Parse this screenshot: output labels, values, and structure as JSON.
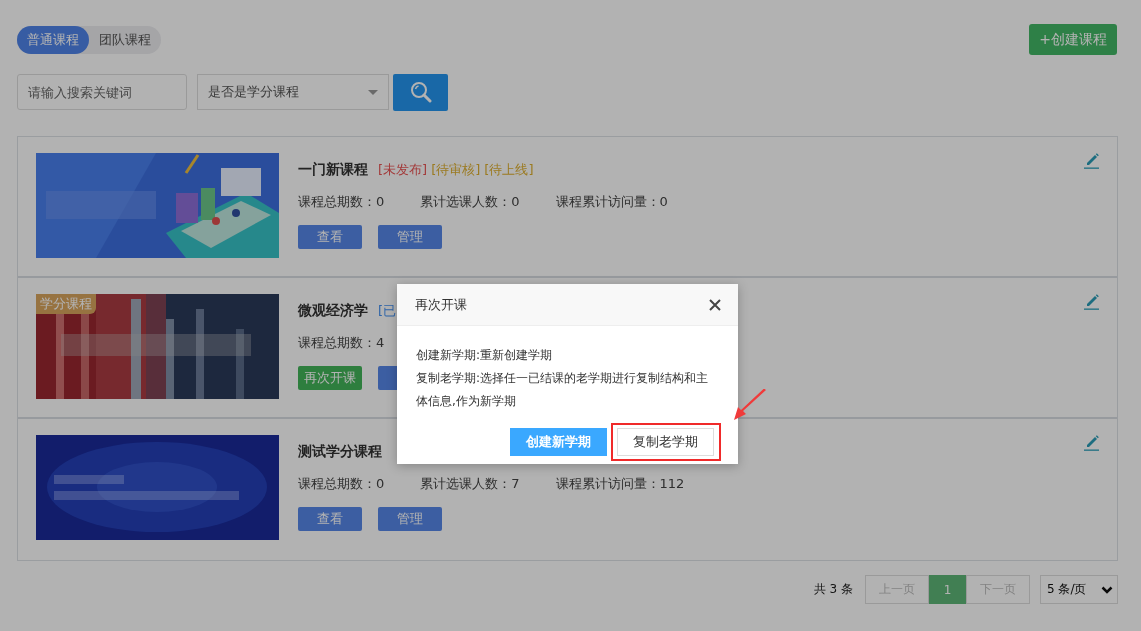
{
  "tabs": [
    {
      "label": "普通课程",
      "selected": true
    },
    {
      "label": "团队课程",
      "selected": false
    }
  ],
  "create_button": {
    "label": "+创建课程"
  },
  "search": {
    "placeholder": "请输入搜索关键词"
  },
  "filter": {
    "placeholder": "是否是学分课程"
  },
  "courses": [
    {
      "title": "一门新课程",
      "picture": {
        "kind": "picture"
      },
      "tags": [
        {
          "text": "[未发布]",
          "color": "#a33a3a"
        },
        {
          "text": "[待审核]",
          "color": "#9b7a20"
        },
        {
          "text": "[待上线]",
          "color": "#9b7a20"
        }
      ],
      "stats": [
        "课程总期数：0",
        "累计选课人数：0",
        "课程累计访问量：0"
      ],
      "buttons": [
        {
          "label": "查看",
          "kind": "primary"
        },
        {
          "label": "管理",
          "kind": "primary"
        }
      ]
    },
    {
      "title": "微观经济学",
      "credit_badge": "学分课程",
      "picture": {
        "kind": "picture"
      },
      "tags": [
        {
          "text": "[已",
          "color": "#2e64a8"
        }
      ],
      "stats": [
        "课程总期数：4"
      ],
      "buttons": [
        {
          "label": "再次开课",
          "kind": "success"
        },
        {
          "kind": "primary"
        }
      ]
    },
    {
      "title": "测试学分课程",
      "picture": {
        "kind": "picture"
      },
      "stats": [
        "课程总期数：0",
        "累计选课人数：7",
        "课程累计访问量：112"
      ],
      "buttons": [
        {
          "label": "查看",
          "kind": "primary"
        },
        {
          "label": "管理",
          "kind": "primary"
        }
      ]
    }
  ],
  "pagination": {
    "total": "共 3 条",
    "prev": {
      "label": "上一页",
      "disabled": true
    },
    "pages": [
      {
        "label": "1",
        "selected": true
      }
    ],
    "next": {
      "label": "下一页",
      "disabled": true
    },
    "page_size": "5 条/页"
  },
  "dialog": {
    "title": "再次开课",
    "lines": [
      "创建新学期:重新创建学期",
      "复制老学期:选择任一已结课的老学期进行复制结构和主体信息,作为新学期"
    ],
    "buttons": [
      {
        "label": "创建新学期",
        "kind": "primary",
        "highlighted": false
      },
      {
        "label": "复制老学期",
        "kind": "default",
        "highlighted": true
      }
    ]
  }
}
